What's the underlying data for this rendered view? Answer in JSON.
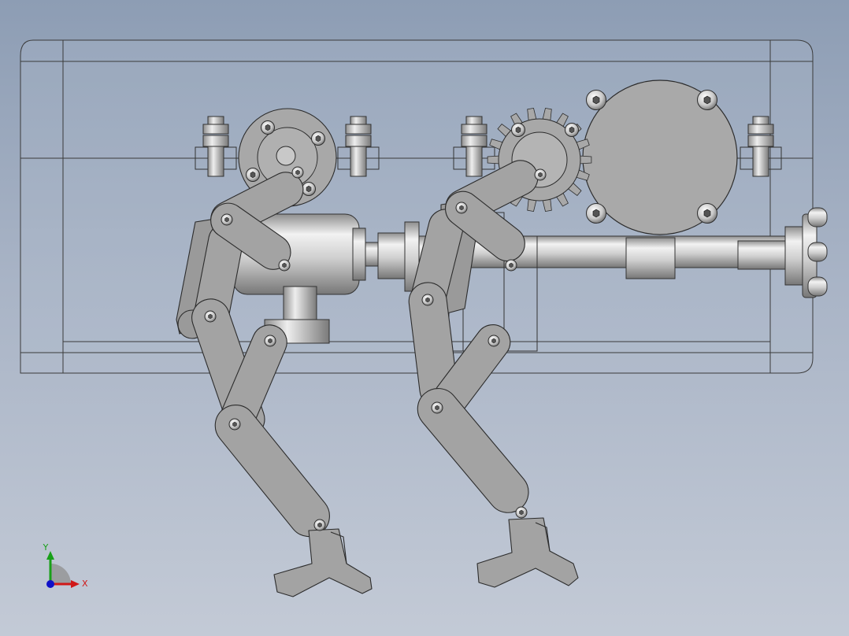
{
  "viewport": {
    "view": "front",
    "background_top": "#8d9db4",
    "background_bottom": "#c3cad6",
    "part_fill": "#a3a3a3",
    "part_edge": "#2c2c2c"
  },
  "assembly": {
    "parts": [
      {
        "name": "housing-frame"
      },
      {
        "name": "front-leg"
      },
      {
        "name": "rear-leg"
      },
      {
        "name": "gear-motor"
      },
      {
        "name": "drive-shaft"
      },
      {
        "name": "spur-gear"
      },
      {
        "name": "crank-disc"
      },
      {
        "name": "standoff-bolt",
        "count": 4
      }
    ]
  },
  "triad": {
    "x_label": "X",
    "y_label": "Y",
    "x_color": "#d01818",
    "y_color": "#18a018",
    "z_color": "#1010c8",
    "x_icon": "x-axis-arrow-icon",
    "y_icon": "y-axis-arrow-icon",
    "z_icon": "z-axis-dot-icon"
  }
}
